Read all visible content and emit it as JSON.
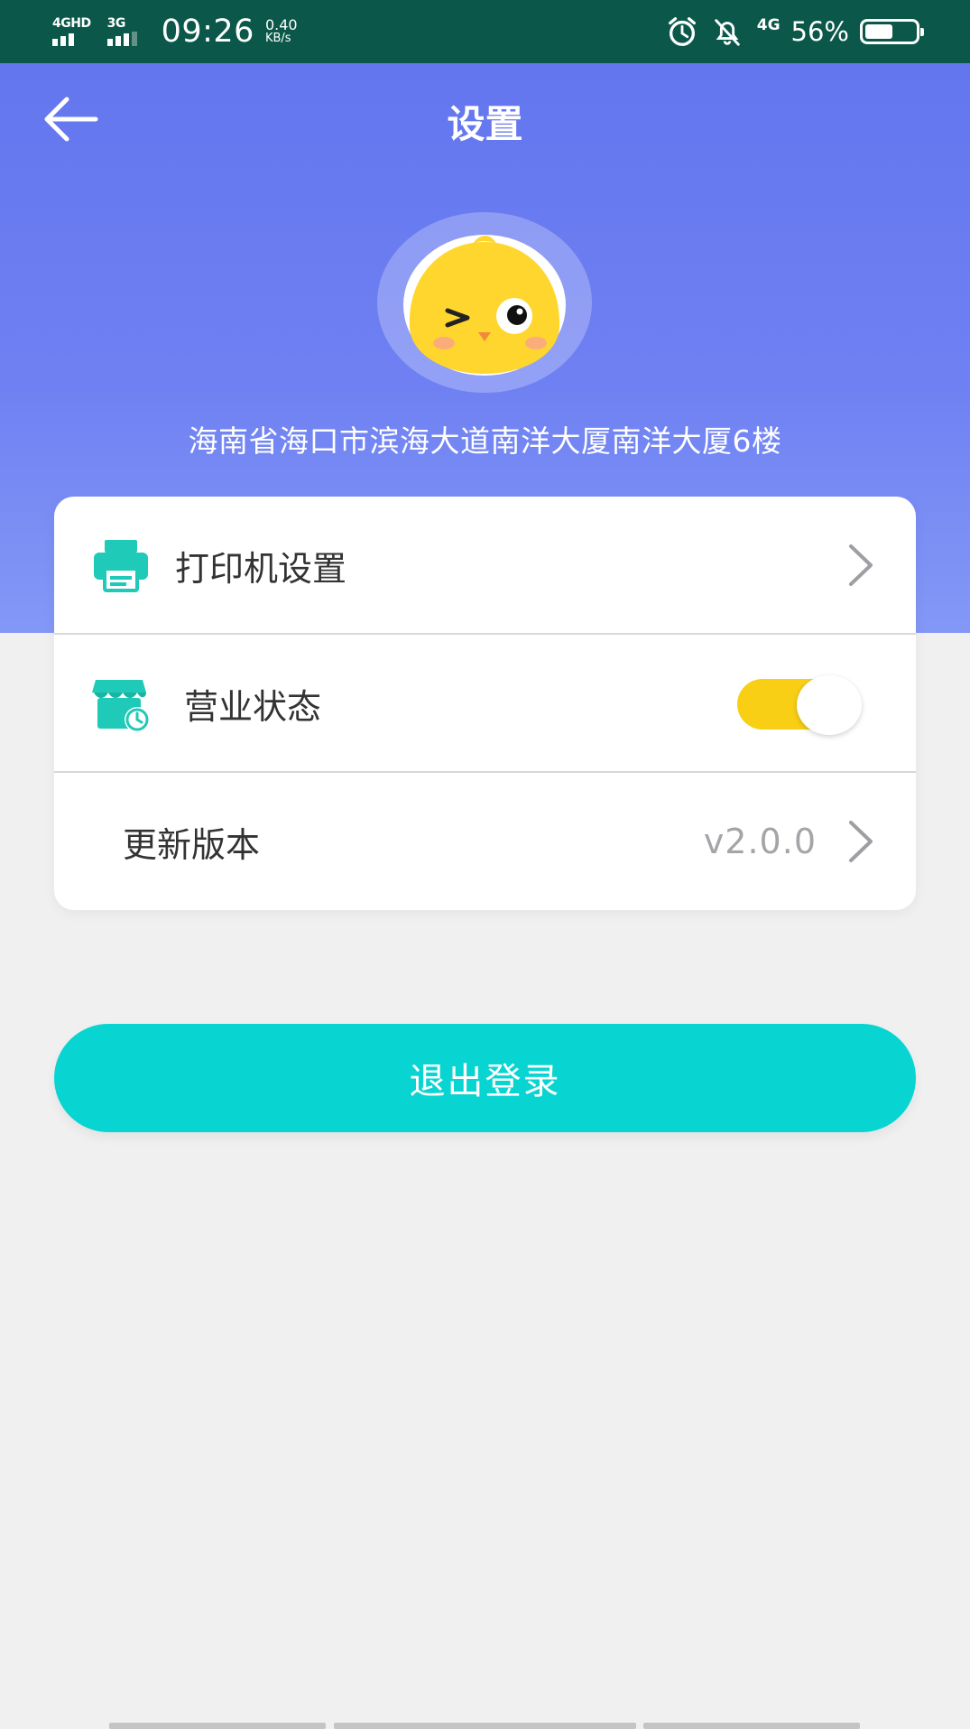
{
  "status_bar": {
    "sim1": "4GHD",
    "sim2": "3G",
    "time": "09:26",
    "net_speed": "0.40",
    "net_unit": "KB/s",
    "network": "4G",
    "battery_percent": "56%",
    "battery_level": 0.56,
    "icons": [
      "alarm-icon",
      "mute-bell-icon"
    ]
  },
  "header": {
    "title": "设置",
    "back_icon": "arrow-left-icon"
  },
  "profile": {
    "avatar": "chick-avatar",
    "address": "海南省海口市滨海大道南洋大厦南洋大厦6楼"
  },
  "settings": {
    "printer": {
      "label": "打印机设置",
      "icon": "printer-icon"
    },
    "business_status": {
      "label": "营业状态",
      "icon": "store-clock-icon",
      "enabled": true
    },
    "update": {
      "label": "更新版本",
      "version": "v2.0.0"
    }
  },
  "logout": {
    "label": "退出登录"
  },
  "colors": {
    "status_bar": "#0b584a",
    "header_gradient_top": "#6476ee",
    "accent_teal": "#08d5d2",
    "icon_teal": "#1fcab8",
    "toggle_on": "#f8cf14",
    "background": "#f1f0f1"
  }
}
